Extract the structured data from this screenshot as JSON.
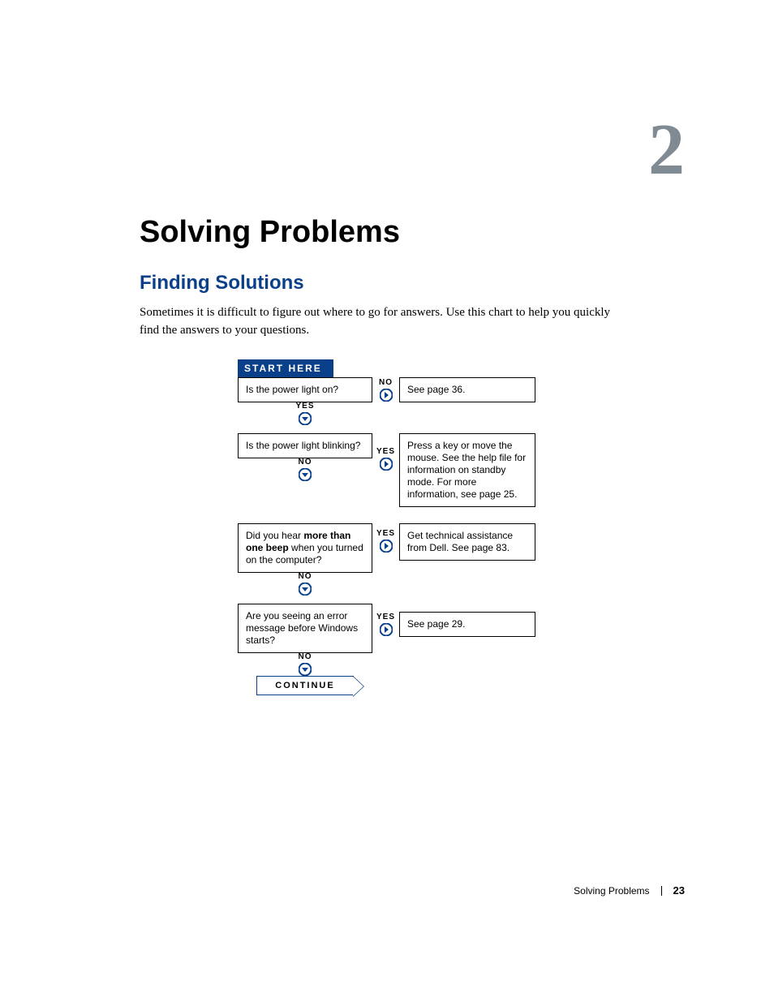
{
  "chapter_number": "2",
  "title": "Solving Problems",
  "section_title": "Finding Solutions",
  "intro": "Sometimes it is difficult to figure out where to go for answers. Use this chart to help you quickly find the answers to your questions.",
  "flow": {
    "start_label": "START HERE",
    "continue_label": "CONTINUE",
    "yes_label": "YES",
    "no_label": "NO",
    "steps": [
      {
        "question": "Is the power light on?",
        "side_label": "NO",
        "down_label": "YES",
        "answer": "See page 36."
      },
      {
        "question": "Is the power light blinking?",
        "side_label": "YES",
        "down_label": "NO",
        "answer": "Press a key or move the mouse. See the help file for information on standby mode. For more information, see page 25."
      },
      {
        "question_html": "Did you hear <b>more than one beep</b> when you turned on the computer?",
        "question": "Did you hear more than one beep when you turned on the computer?",
        "side_label": "YES",
        "down_label": "NO",
        "answer": "Get technical assistance from Dell. See page 83."
      },
      {
        "question": "Are you seeing an error message before Windows starts?",
        "side_label": "YES",
        "down_label": "NO",
        "answer": "See page 29."
      }
    ]
  },
  "footer": {
    "section": "Solving Problems",
    "page": "23"
  }
}
